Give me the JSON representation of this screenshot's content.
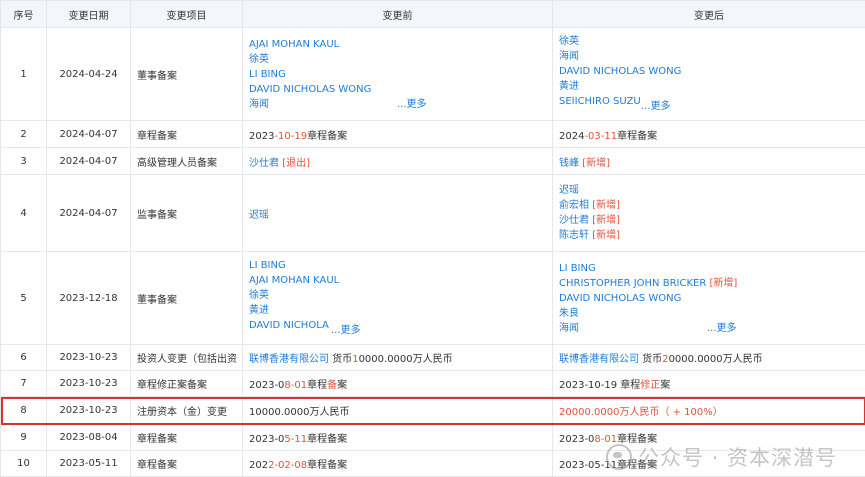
{
  "headers": {
    "seq": "序号",
    "date": "变更日期",
    "item": "变更项目",
    "before": "变更前",
    "after": "变更后"
  },
  "more_label": "...更多",
  "rows": [
    {
      "seq": "1",
      "date": "2024-04-24",
      "item": "董事备案",
      "before": [
        "AJAI MOHAN KAUL",
        "徐英",
        "LI BING",
        "DAVID NICHOLAS WONG",
        "海闻"
      ],
      "after": [
        "徐英",
        "海闻",
        "DAVID NICHOLAS WONG",
        "黄进",
        "SEIICHIRO SUZU"
      ]
    },
    {
      "seq": "2",
      "date": "2024-04-07",
      "item": "章程备案",
      "before_a": "2023",
      "before_b": "-10-19",
      "before_c": "章程备案",
      "after_a": "2024",
      "after_b": "-03-11",
      "after_c": "章程备案"
    },
    {
      "seq": "3",
      "date": "2024-04-07",
      "item": "高级管理人员备案",
      "before_name": "沙仕君",
      "before_tag": "[退出]",
      "after_name": "钱峰",
      "after_tag": "[新增]"
    },
    {
      "seq": "4",
      "date": "2024-04-07",
      "item": "监事备案",
      "before_name": "迟瑶",
      "after": [
        {
          "name": "迟瑶",
          "tag": ""
        },
        {
          "name": "俞宏相",
          "tag": "[新增]"
        },
        {
          "name": "沙仕君",
          "tag": "[新增]"
        },
        {
          "name": "陈志轩",
          "tag": "[新增]"
        }
      ]
    },
    {
      "seq": "5",
      "date": "2023-12-18",
      "item": "董事备案",
      "before": [
        "LI BING",
        "AJAI MOHAN KAUL",
        "徐英",
        "黄进",
        "DAVID NICHOLA"
      ],
      "after": [
        {
          "name": "LI BING",
          "tag": ""
        },
        {
          "name": "CHRISTOPHER JOHN BRICKER",
          "tag": "[新增]"
        },
        {
          "name": "DAVID NICHOLAS WONG",
          "tag": ""
        },
        {
          "name": "朱良",
          "tag": ""
        },
        {
          "name": "海闻",
          "tag": ""
        }
      ]
    },
    {
      "seq": "6",
      "date": "2023-10-23",
      "item": "投资人变更（包括出资",
      "before_co": "联博香港有限公司",
      "before_a": " 货币",
      "before_b": "1",
      "before_c": "0000.0000万人民币",
      "after_co": "联博香港有限公司",
      "after_a": " 货币",
      "after_b": "2",
      "after_c": "0000.0000万人民币"
    },
    {
      "seq": "7",
      "date": "2023-10-23",
      "item": "章程修正案备案",
      "before_a": "2023-0",
      "before_b": "8-01",
      "before_c": "章程",
      "before_d": "备",
      "before_e": "案",
      "after_a": "2023-10-19 章程",
      "after_b": "修正",
      "after_c": "案"
    },
    {
      "seq": "8",
      "date": "2023-10-23",
      "item": "注册资本（金）变更",
      "before": "10000.0000万人民币",
      "after": "20000.0000万人民币（ + 100%）"
    },
    {
      "seq": "9",
      "date": "2023-08-04",
      "item": "章程备案",
      "before_a": "2023-0",
      "before_b": "5-11",
      "before_c": "章程备案",
      "after_a": "2023-0",
      "after_b": "8-01",
      "after_c": "章程备案"
    },
    {
      "seq": "10",
      "date": "2023-05-11",
      "item": "章程备案",
      "before_a": "202",
      "before_b": "2-02-08",
      "before_c": "章程备案",
      "after_a": "2023-05-11章程备案"
    }
  ],
  "watermark": "公众号 · 资本深潜号"
}
